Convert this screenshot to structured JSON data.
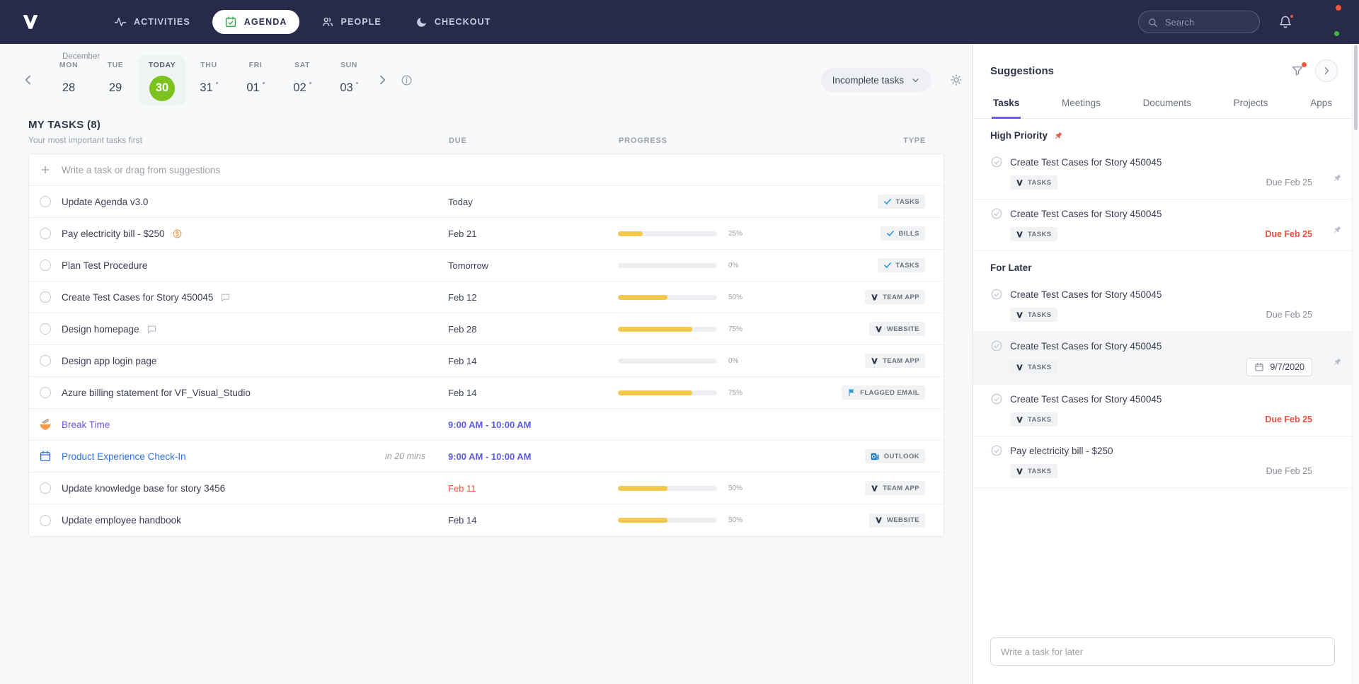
{
  "topbar": {
    "nav": [
      {
        "id": "activities",
        "label": "ACTIVITIES",
        "icon": "activity-icon",
        "active": false
      },
      {
        "id": "agenda",
        "label": "AGENDA",
        "icon": "agenda-calendar-icon",
        "active": true
      },
      {
        "id": "people",
        "label": "PEOPLE",
        "icon": "people-icon",
        "active": false
      },
      {
        "id": "checkout",
        "label": "CHECKOUT",
        "icon": "checkout-moon-icon",
        "active": false
      }
    ],
    "search_placeholder": "Search"
  },
  "datebar": {
    "month_label": "December",
    "days": [
      {
        "dow": "MON",
        "date": "28",
        "today": false,
        "dot": false
      },
      {
        "dow": "TUE",
        "date": "29",
        "today": false,
        "dot": false
      },
      {
        "dow": "TODAY",
        "date": "30",
        "today": true,
        "dot": false
      },
      {
        "dow": "THU",
        "date": "31",
        "today": false,
        "dot": true
      },
      {
        "dow": "FRI",
        "date": "01",
        "today": false,
        "dot": true
      },
      {
        "dow": "SAT",
        "date": "02",
        "today": false,
        "dot": true
      },
      {
        "dow": "SUN",
        "date": "03",
        "today": false,
        "dot": true
      }
    ],
    "filter_label": "Incomplete tasks"
  },
  "tasks": {
    "title": "MY TASKS (8)",
    "subtitle": "Your most important tasks first",
    "columns": {
      "due": "DUE",
      "progress": "PROGRESS",
      "type": "TYPE"
    },
    "add_placeholder": "Write a task or drag from suggestions",
    "rows": [
      {
        "title": "Update Agenda v3.0",
        "lead": "checkbox",
        "due": "Today",
        "progress": null,
        "type": "TASKS",
        "type_icon": "check-blue-icon"
      },
      {
        "title": "Pay electricity bill - $250",
        "lead": "checkbox",
        "bill": true,
        "due": "Feb 21",
        "progress": 25,
        "progress_label": "25%",
        "type": "BILLS",
        "type_icon": "check-blue-icon"
      },
      {
        "title": "Plan Test Procedure",
        "lead": "checkbox",
        "due": "Tomorrow",
        "progress": 0,
        "progress_label": "0%",
        "type": "TASKS",
        "type_icon": "check-blue-icon"
      },
      {
        "title": "Create Test Cases for Story 450045",
        "lead": "checkbox",
        "comment": true,
        "due": "Feb 12",
        "progress": 50,
        "progress_label": "50%",
        "type": "TEAM APP",
        "type_icon": "logo-mark-icon"
      },
      {
        "title": "Design homepage",
        "lead": "checkbox",
        "comment": true,
        "due": "Feb 28",
        "progress": 75,
        "progress_label": "75%",
        "type": "WEBSITE",
        "type_icon": "logo-mark-icon"
      },
      {
        "title": "Design app login page",
        "lead": "checkbox",
        "due": "Feb 14",
        "progress": 0,
        "progress_label": "0%",
        "type": "TEAM APP",
        "type_icon": "logo-mark-icon"
      },
      {
        "title": "Azure billing statement for VF_Visual_Studio",
        "lead": "checkbox",
        "due": "Feb 14",
        "progress": 75,
        "progress_label": "75%",
        "type": "FLAGGED EMAIL",
        "type_icon": "flag-icon"
      },
      {
        "title": "Break Time",
        "lead": "food-icon",
        "style": "break",
        "due": "9:00 AM - 10:00 AM",
        "due_style": "time",
        "progress": null
      },
      {
        "title": "Product Experience Check-In",
        "lead": "calendar-blue-icon",
        "style": "event",
        "note": "in 20 mins",
        "due": "9:00 AM - 10:00 AM",
        "due_style": "time",
        "progress": null,
        "type": "OUTLOOK",
        "type_icon": "outlook-icon"
      },
      {
        "title": "Update knowledge base for story 3456",
        "lead": "checkbox",
        "due": "Feb 11",
        "due_style": "overdue",
        "progress": 50,
        "progress_label": "50%",
        "type": "TEAM APP",
        "type_icon": "logo-mark-icon"
      },
      {
        "title": "Update employee handbook",
        "lead": "checkbox",
        "due": "Feb 14",
        "progress": 50,
        "progress_label": "50%",
        "type": "WEBSITE",
        "type_icon": "logo-mark-icon"
      }
    ]
  },
  "suggestions": {
    "title": "Suggestions",
    "tabs": [
      {
        "label": "Tasks",
        "active": true
      },
      {
        "label": "Meetings",
        "active": false
      },
      {
        "label": "Documents",
        "active": false
      },
      {
        "label": "Projects",
        "active": false
      },
      {
        "label": "Apps",
        "active": false
      }
    ],
    "sections": [
      {
        "title": "High Priority",
        "pin": true,
        "items": [
          {
            "title": "Create Test Cases for Story 450045",
            "badge": "TASKS",
            "due": "Due Feb 25",
            "overdue": false,
            "pinned": true
          },
          {
            "title": "Create Test Cases for Story 450045",
            "badge": "TASKS",
            "due": "Due Feb 25",
            "overdue": true,
            "pinned": true
          }
        ]
      },
      {
        "title": "For Later",
        "pin": false,
        "items": [
          {
            "title": "Create Test Cases for Story 450045",
            "badge": "TASKS",
            "due": "Due Feb 25",
            "overdue": false,
            "pinned": false
          },
          {
            "title": "Create Test Cases for Story 450045",
            "badge": "TASKS",
            "date_value": "9/7/2020",
            "highlighted": true,
            "pinned": true
          },
          {
            "title": "Create Test Cases for Story 450045",
            "badge": "TASKS",
            "due": "Due Feb 25",
            "overdue": true,
            "pinned": false
          },
          {
            "title": "Pay electricity bill - $250",
            "badge": "TASKS",
            "due": "Due Feb 25",
            "overdue": false,
            "pinned": false
          }
        ]
      }
    ],
    "add_placeholder": "Write a task for later"
  },
  "colors": {
    "topbar": "#272b49",
    "accent_green": "#7dc31f",
    "accent_yellow": "#f2c94c",
    "accent_red": "#f0563a",
    "accent_purple": "#6c5ce7",
    "accent_blue": "#2d9cdb"
  }
}
